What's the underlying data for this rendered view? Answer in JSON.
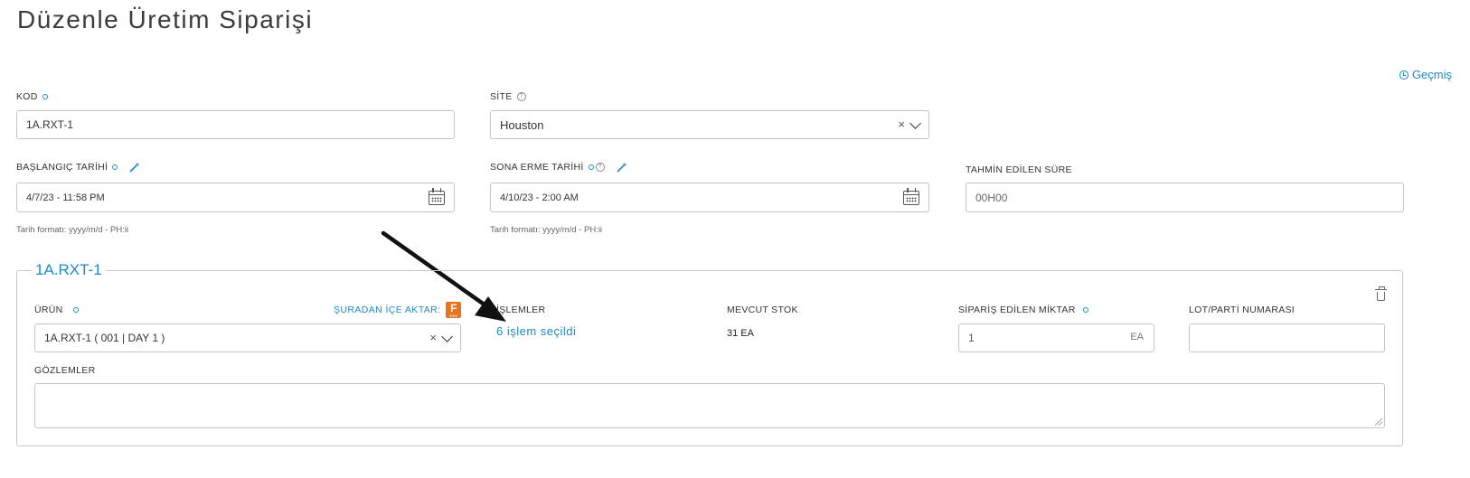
{
  "page": {
    "title": "Düzenle Üretim Siparişi"
  },
  "header": {
    "history_label": "Geçmiş"
  },
  "form": {
    "kod": {
      "label": "KOD",
      "value": "1A.RXT-1"
    },
    "site": {
      "label": "SİTE",
      "value": "Houston"
    },
    "start_date": {
      "label": "BAŞLANGIÇ TARİHİ",
      "value": "4/7/23 - 11:58 PM",
      "hint": "Tarih formatı: yyyy/m/d - PH:ii"
    },
    "end_date": {
      "label": "SONA ERME TARİHİ",
      "value": "4/10/23 - 2:00 AM",
      "hint": "Tarih formatı: yyyy/m/d - PH:ii"
    },
    "duration": {
      "label": "TAHMİN EDİLEN SÜRE",
      "placeholder": "00H00"
    }
  },
  "order_line": {
    "legend": "1A.RXT-1",
    "product": {
      "label": "ÜRÜN",
      "value": "1A.RXT-1 ( 001 | DAY 1 )"
    },
    "import": {
      "label": "ŞURADAN İÇE AKTAR:",
      "icon_letter": "F",
      "icon_sub": "FAV"
    },
    "operations": {
      "label": "İŞLEMLER",
      "link": "6 işlem seçildi"
    },
    "stock": {
      "label": "MEVCUT STOK",
      "value": "31 EA"
    },
    "ordered_qty": {
      "label": "SİPARİŞ EDİLEN MİKTAR",
      "value": "1",
      "unit": "EA"
    },
    "lot": {
      "label": "LOT/PARTİ NUMARASI",
      "value": ""
    },
    "notes": {
      "label": "GÖZLEMLER",
      "value": ""
    }
  },
  "colors": {
    "accent": "#1f8ac4",
    "import_icon": "#e8731f"
  }
}
